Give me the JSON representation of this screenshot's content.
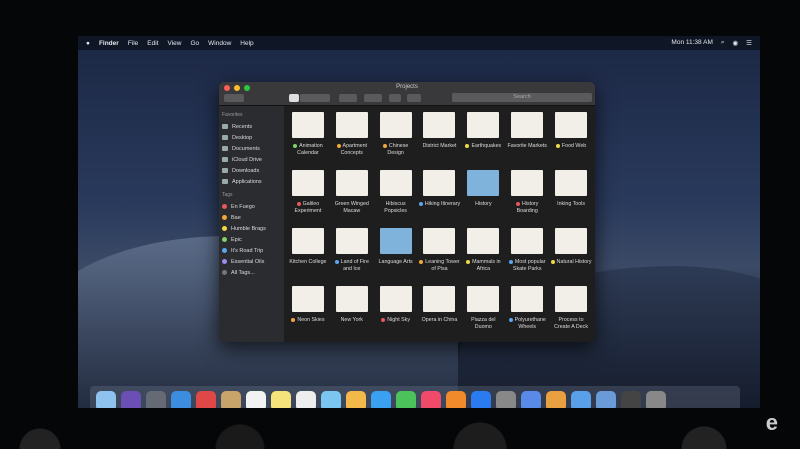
{
  "menubar": {
    "app": "Finder",
    "items": [
      "File",
      "Edit",
      "View",
      "Go",
      "Window",
      "Help"
    ],
    "clock": "Mon 11:38 AM"
  },
  "window": {
    "title": "Projects",
    "search_placeholder": "Search"
  },
  "sidebar": {
    "favorites_header": "Favorites",
    "favorites": [
      "Recents",
      "Desktop",
      "Documents",
      "iCloud Drive",
      "Downloads",
      "Applications"
    ],
    "tags_header": "Tags",
    "tags": [
      {
        "label": "En Fuego",
        "color": "#e8575a"
      },
      {
        "label": "Bae",
        "color": "#f0a83a"
      },
      {
        "label": "Humble Brags",
        "color": "#f0d84a"
      },
      {
        "label": "Epic",
        "color": "#7ed36a"
      },
      {
        "label": "It's Road Trip",
        "color": "#5aa6f0"
      },
      {
        "label": "Essential Oils",
        "color": "#9c8cf0"
      },
      {
        "label": "All Tags...",
        "color": "#777777"
      }
    ]
  },
  "files": [
    {
      "name": "Animation Calendar",
      "tag": "#7ed36a"
    },
    {
      "name": "Apartment Concepts",
      "tag": "#f0a83a"
    },
    {
      "name": "Chinese Design",
      "tag": "#f0a83a"
    },
    {
      "name": "District Market",
      "tag": null
    },
    {
      "name": "Earthquakes",
      "tag": "#f0d84a"
    },
    {
      "name": "Favorite Markets",
      "tag": null
    },
    {
      "name": "Food Web",
      "tag": "#f0d84a"
    },
    {
      "name": "Galileo Experiment",
      "tag": "#e8575a"
    },
    {
      "name": "Green Winged Macaw",
      "tag": null
    },
    {
      "name": "Hibiscus Popsicles",
      "tag": null
    },
    {
      "name": "Hiking Itinerary",
      "tag": "#5aa6f0"
    },
    {
      "name": "History",
      "tag": null,
      "folder": true
    },
    {
      "name": "History Boarding",
      "tag": "#e8575a"
    },
    {
      "name": "Inking Tools",
      "tag": null
    },
    {
      "name": "Kitchen College",
      "tag": null
    },
    {
      "name": "Land of Fire and Ice",
      "tag": "#5aa6f0"
    },
    {
      "name": "Language Arts",
      "tag": null,
      "folder": true
    },
    {
      "name": "Leaning Tower of Pisa",
      "tag": "#f0a83a"
    },
    {
      "name": "Mammals in Africa",
      "tag": "#f0d84a"
    },
    {
      "name": "Most popular Skate Parks",
      "tag": "#5aa6f0"
    },
    {
      "name": "Natural History",
      "tag": "#f0d84a"
    },
    {
      "name": "Neon Skies",
      "tag": "#f0a83a"
    },
    {
      "name": "New York",
      "tag": null
    },
    {
      "name": "Night Sky",
      "tag": "#e8575a"
    },
    {
      "name": "Opera in China",
      "tag": null
    },
    {
      "name": "Piazza del Duomo",
      "tag": null
    },
    {
      "name": "Polyurethane Wheels",
      "tag": "#5aa6f0"
    },
    {
      "name": "Process to Create A Deck",
      "tag": null
    }
  ],
  "dock_colors": [
    "#8fc3ef",
    "#6a4fb5",
    "#666a75",
    "#3c8de0",
    "#e04848",
    "#c9a46a",
    "#f2f2f2",
    "#f5e27a",
    "#eee",
    "#7ac6f0",
    "#f2b84a",
    "#3aa0f0",
    "#4cc25a",
    "#f04a6a",
    "#f08a2a",
    "#2a7af0",
    "#888",
    "#5a8ae8",
    "#e8a040",
    "#5aa0e8",
    "#6a9ad8",
    "#444",
    "#888"
  ],
  "logo": "e"
}
